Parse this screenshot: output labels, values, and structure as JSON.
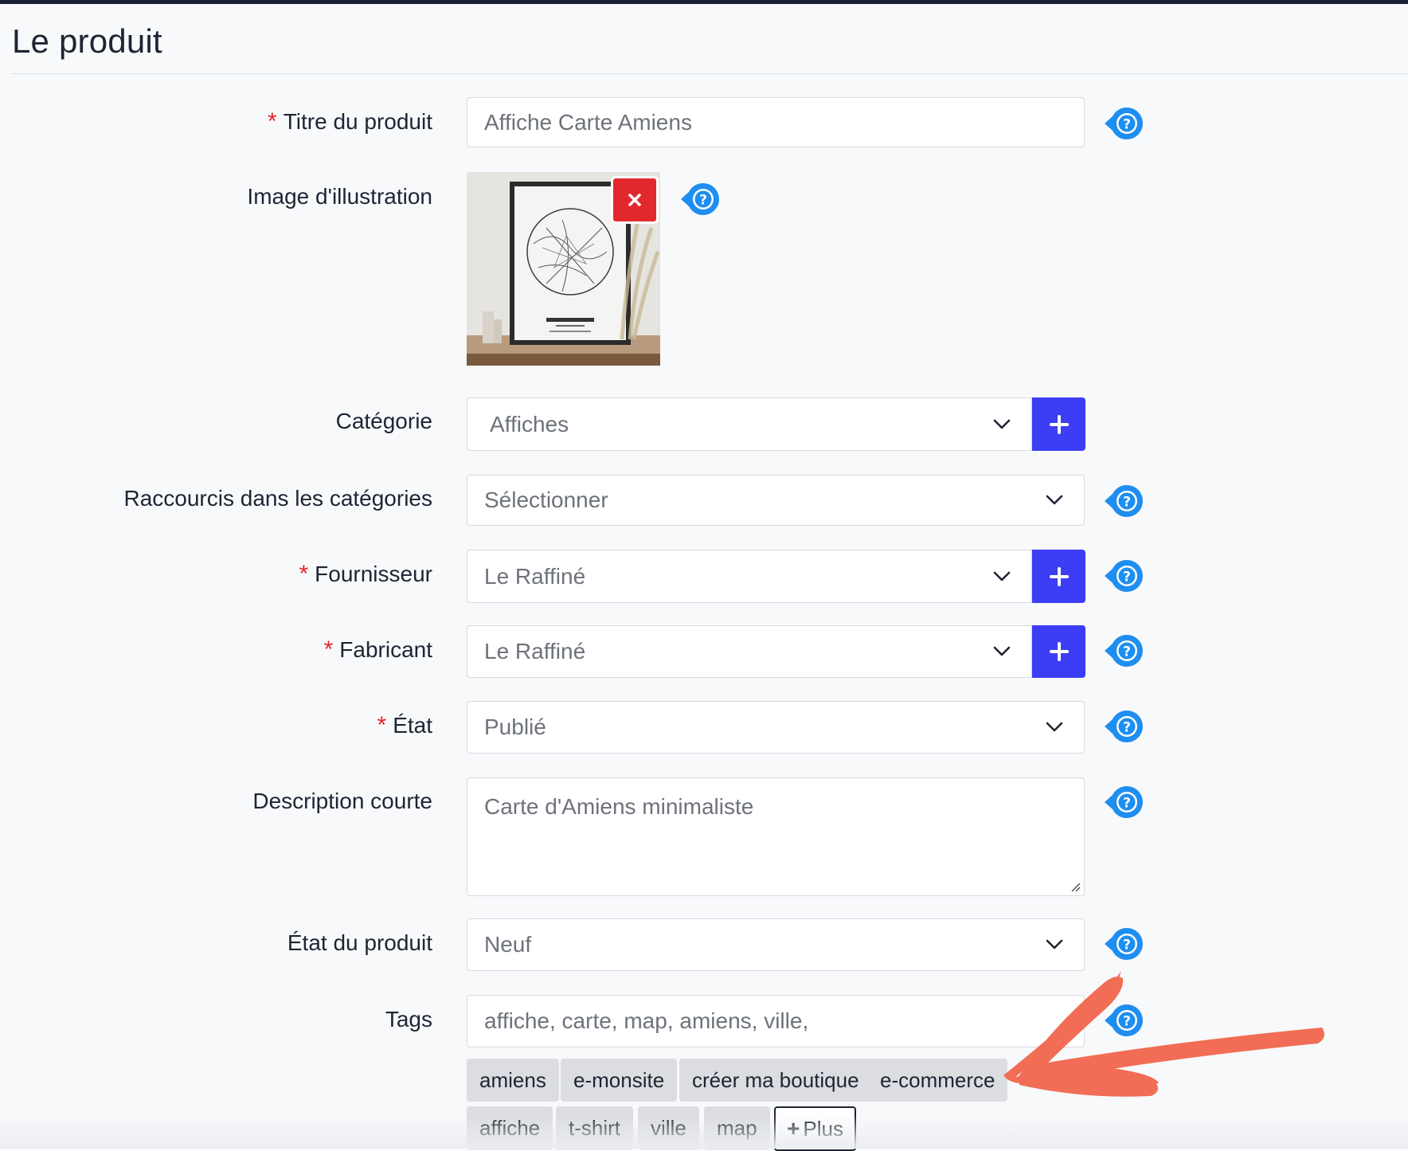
{
  "section": {
    "title": "Le produit"
  },
  "required_mark": "*",
  "fields": {
    "title": {
      "label": "Titre du produit",
      "value": "Affiche Carte Amiens"
    },
    "image": {
      "label": "Image d'illustration"
    },
    "category": {
      "label": "Catégorie",
      "value": "Affiches"
    },
    "shortcuts": {
      "label": "Raccourcis dans les catégories",
      "value": "Sélectionner"
    },
    "supplier": {
      "label": "Fournisseur",
      "value": "Le Raffiné"
    },
    "manufacturer": {
      "label": "Fabricant",
      "value": "Le Raffiné"
    },
    "status": {
      "label": "État",
      "value": "Publié"
    },
    "short_description": {
      "label": "Description courte",
      "value": "Carte d'Amiens minimaliste"
    },
    "condition": {
      "label": "État du produit",
      "value": "Neuf"
    },
    "tags": {
      "label": "Tags",
      "value": "affiche, carte, map, amiens, ville,",
      "suggestions_row1": [
        "amiens",
        "e-monsite",
        "créer ma boutique",
        "e-commerce"
      ],
      "suggestions_row2": [
        "affiche",
        "t-shirt",
        "ville",
        "map"
      ],
      "more_label": "Plus"
    }
  },
  "colors": {
    "accent_blue": "#3c3ef5",
    "help_blue": "#1e8ef0",
    "danger_red": "#e3282d",
    "annotation_arrow": "#f26d55"
  },
  "icons": {
    "help": "question-circle-icon",
    "add": "plus-icon",
    "remove": "x-icon",
    "dropdown": "chevron-down-icon"
  }
}
